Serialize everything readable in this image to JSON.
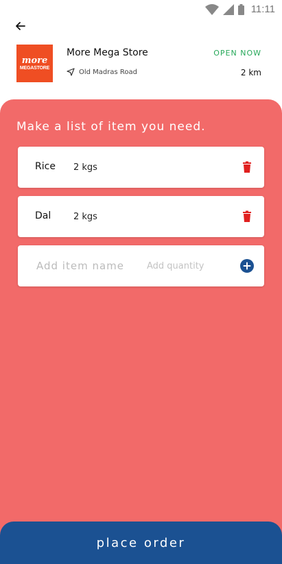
{
  "status_bar": {
    "time": "11:11"
  },
  "store": {
    "name": "More Mega Store",
    "logo_top": "more",
    "logo_bottom": "MEGASTORE",
    "address": "Old Madras Road",
    "status": "OPEN NOW",
    "distance": "2 km"
  },
  "list": {
    "title": "Make a list of item you need.",
    "items": [
      {
        "name": "Rice",
        "quantity": "2 kgs"
      },
      {
        "name": "Dal",
        "quantity": "2 kgs"
      }
    ],
    "add_name_placeholder": "Add item name",
    "add_quantity_placeholder": "Add quantity"
  },
  "actions": {
    "place_order_label": "place order"
  },
  "colors": {
    "panel": "#f26a69",
    "primary": "#1b5192",
    "open_status": "#27a85a",
    "delete": "#e0201f",
    "logo_bg": "#ef4e23"
  },
  "icons": {
    "back": "arrow-left-icon",
    "location": "navigation-arrow-icon",
    "delete": "trash-icon",
    "add": "plus-circle-icon",
    "wifi": "wifi-icon",
    "signal": "signal-icon",
    "battery": "battery-icon"
  }
}
